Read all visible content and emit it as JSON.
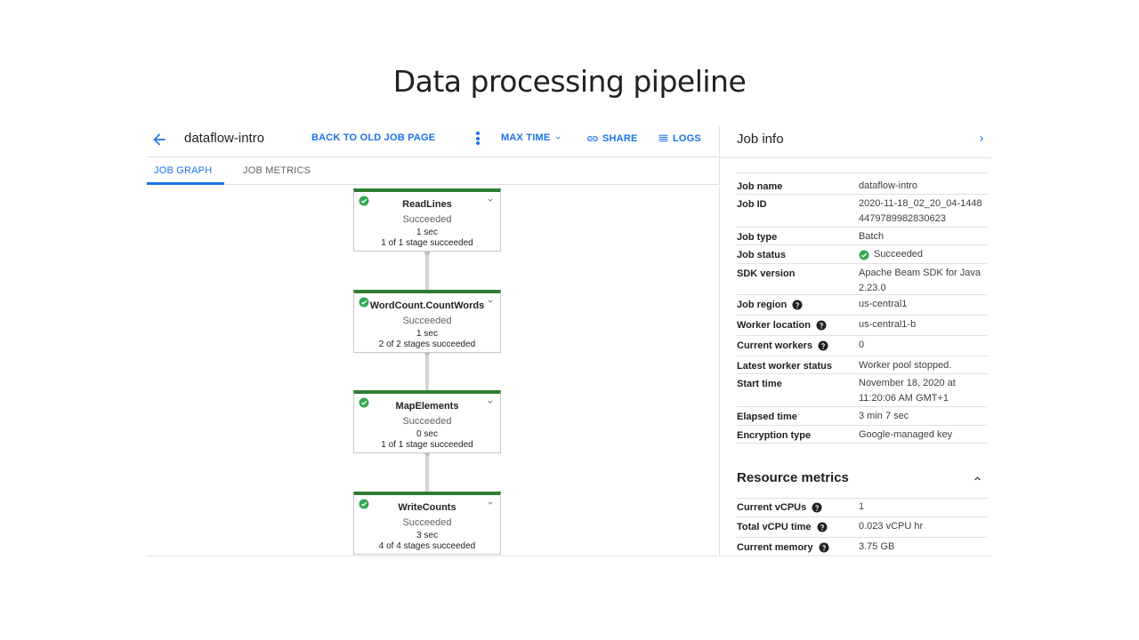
{
  "slide": {
    "title": "Data processing pipeline"
  },
  "toolbar": {
    "job_name": "dataflow-intro",
    "back_old": "BACK TO OLD JOB PAGE",
    "max_time": "MAX TIME",
    "share": "SHARE",
    "logs": "LOGS"
  },
  "tabs": [
    {
      "label": "JOB GRAPH",
      "active": true
    },
    {
      "label": "JOB METRICS",
      "active": false
    }
  ],
  "graph": {
    "nodes": [
      {
        "name": "ReadLines",
        "status": "Succeeded",
        "time": "1 sec",
        "stages": "1 of 1 stage succeeded"
      },
      {
        "name": "WordCount.CountWords",
        "status": "Succeeded",
        "time": "1 sec",
        "stages": "2 of 2 stages succeeded"
      },
      {
        "name": "MapElements",
        "status": "Succeeded",
        "time": "0 sec",
        "stages": "1 of 1 stage succeeded"
      },
      {
        "name": "WriteCounts",
        "status": "Succeeded",
        "time": "3 sec",
        "stages": "4 of 4 stages succeeded"
      }
    ]
  },
  "job_info": {
    "title": "Job info",
    "rows": [
      {
        "key": "Job name",
        "value": "dataflow-intro"
      },
      {
        "key": "Job ID",
        "value": "2020-11-18_02_20_04-14484479789982830623"
      },
      {
        "key": "Job type",
        "value": "Batch"
      },
      {
        "key": "Job status",
        "value": "Succeeded"
      },
      {
        "key": "SDK version",
        "value": "Apache Beam SDK for Java 2.23.0"
      },
      {
        "key": "Job region",
        "value": "us-central1"
      },
      {
        "key": "Worker location",
        "value": "us-central1-b"
      },
      {
        "key": "Current workers",
        "value": "0"
      },
      {
        "key": "Latest worker status",
        "value": "Worker pool stopped."
      },
      {
        "key": "Start time",
        "value": "November 18, 2020 at 11:20:06 AM GMT+1"
      },
      {
        "key": "Elapsed time",
        "value": "3 min 7 sec"
      },
      {
        "key": "Encryption type",
        "value": "Google-managed key"
      }
    ]
  },
  "resource_metrics": {
    "title": "Resource metrics",
    "rows": [
      {
        "key": "Current vCPUs",
        "value": "1"
      },
      {
        "key": "Total vCPU time",
        "value": "0.023 vCPU hr"
      },
      {
        "key": "Current memory",
        "value": "3.75 GB"
      }
    ]
  },
  "colors": {
    "accent": "#1a73e8",
    "success": "#2e7d32",
    "success_icon": "#34a853"
  },
  "icons": {
    "back": "arrow-left-icon",
    "kebab": "more-vert-icon",
    "dropdown": "chevron-down-icon",
    "share": "link-icon",
    "logs": "list-icon",
    "node_status": "check-circle-icon",
    "node_expand": "chevron-down-icon",
    "panel_collapse": "chevron-right-icon",
    "help": "help-icon",
    "section_collapse": "chevron-up-icon"
  }
}
